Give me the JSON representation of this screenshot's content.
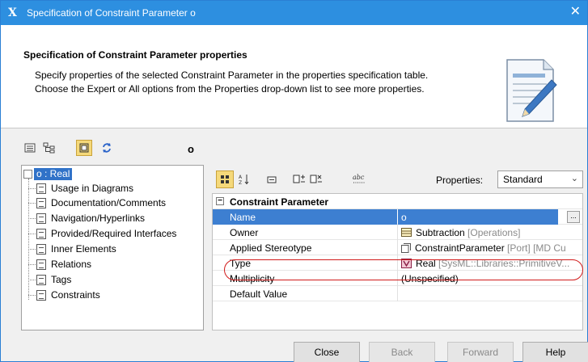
{
  "window": {
    "title": "Specification of Constraint Parameter o",
    "close_glyph": "✕",
    "app_glyph": "X"
  },
  "header": {
    "title": "Specification of Constraint Parameter properties",
    "line1": "Specify properties of the selected Constraint Parameter in the properties specification table.",
    "line2": "Choose the Expert or All options from the Properties drop-down list to see more properties.",
    "icon": "document-pencil-icon"
  },
  "toolbar": {
    "element_label": "o",
    "icons": [
      "list-view-icon",
      "tree-view-icon",
      "layout-icon",
      "refresh-icon"
    ]
  },
  "tree": {
    "root_label": "o : Real",
    "items": [
      "Usage in Diagrams",
      "Documentation/Comments",
      "Navigation/Hyperlinks",
      "Provided/Required Interfaces",
      "Inner Elements",
      "Relations",
      "Tags",
      "Constraints"
    ]
  },
  "properties": {
    "label": "Properties:",
    "selected": "Standard",
    "category": "Constraint Parameter",
    "rows": [
      {
        "name": "Name",
        "value": "o",
        "extra": ""
      },
      {
        "name": "Owner",
        "value": "Subtraction",
        "extra": " [Operations]"
      },
      {
        "name": "Applied Stereotype",
        "value": "ConstraintParameter",
        "extra": " [Port] [MD Cu"
      },
      {
        "name": "Type",
        "value": "Real",
        "extra": " [SysML::Libraries::PrimitiveV..."
      },
      {
        "name": "Multiplicity",
        "value": "(Unspecified)",
        "extra": ""
      },
      {
        "name": "Default Value",
        "value": "",
        "extra": ""
      }
    ],
    "ellipsis": "..."
  },
  "buttons": {
    "close": "Close",
    "back": "Back",
    "forward": "Forward",
    "help": "Help"
  },
  "colors": {
    "titlebar": "#2d8fe0",
    "selection": "#3d7fd1",
    "highlight": "#d11a1a"
  }
}
